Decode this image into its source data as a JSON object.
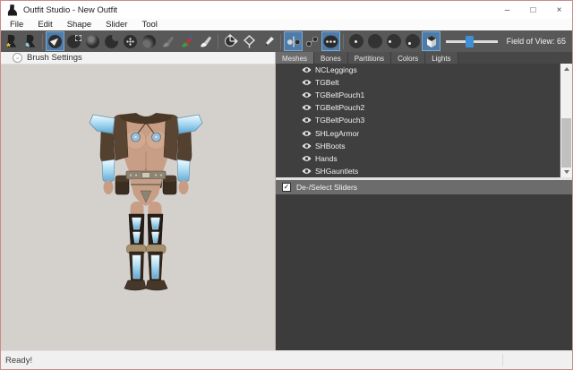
{
  "window": {
    "title": "Outfit Studio - New Outfit",
    "controls": {
      "minimize": "–",
      "maximize": "□",
      "close": "×"
    }
  },
  "menu": {
    "items": [
      "File",
      "Edit",
      "Shape",
      "Slider",
      "Tool"
    ]
  },
  "toolbar": {
    "field_of_view_label": "Field of View: 65",
    "field_of_view_value": 65,
    "tools": [
      {
        "name": "load-outfit",
        "state": "normal"
      },
      {
        "name": "load-reference",
        "state": "normal"
      },
      {
        "name": "select-tool",
        "state": "active"
      },
      {
        "name": "mask-brush",
        "state": "normal"
      },
      {
        "name": "inflate-brush",
        "state": "normal"
      },
      {
        "name": "deflate-brush",
        "state": "normal"
      },
      {
        "name": "move-brush",
        "state": "normal"
      },
      {
        "name": "smooth-brush",
        "state": "normal"
      },
      {
        "name": "weight-brush",
        "state": "disabled"
      },
      {
        "name": "color-brush",
        "state": "normal"
      },
      {
        "name": "alpha-brush",
        "state": "normal"
      },
      {
        "name": "transform-tool",
        "state": "normal"
      },
      {
        "name": "pivot-tool",
        "state": "normal"
      },
      {
        "name": "vertex-edit-tool",
        "state": "normal"
      },
      {
        "name": "x-mirror-toggle",
        "state": "active"
      },
      {
        "name": "edit-connected-toggle",
        "state": "normal"
      },
      {
        "name": "global-brush-collision-toggle",
        "state": "active"
      },
      {
        "name": "brush-falloff-1",
        "state": "normal"
      },
      {
        "name": "brush-falloff-2",
        "state": "normal"
      },
      {
        "name": "brush-falloff-3",
        "state": "normal"
      },
      {
        "name": "brush-falloff-4",
        "state": "normal"
      },
      {
        "name": "perspective-toggle",
        "state": "active"
      }
    ]
  },
  "left_panel": {
    "header": "Brush Settings"
  },
  "right_panel": {
    "tabs": [
      {
        "label": "Meshes",
        "selected": true
      },
      {
        "label": "Bones",
        "selected": false
      },
      {
        "label": "Partitions",
        "selected": false
      },
      {
        "label": "Colors",
        "selected": false
      },
      {
        "label": "Lights",
        "selected": false
      }
    ],
    "mesh_list": [
      {
        "label": "NCLeggings"
      },
      {
        "label": "TGBelt"
      },
      {
        "label": "TGBeltPouch1"
      },
      {
        "label": "TGBeltPouch2"
      },
      {
        "label": "TGBeltPouch3"
      },
      {
        "label": "SHLegArmor"
      },
      {
        "label": "SHBoots"
      },
      {
        "label": "Hands"
      },
      {
        "label": "SHGauntlets"
      }
    ],
    "sliders_panel": {
      "header": "De-/Select Sliders",
      "checked": true,
      "check_glyph": "✓"
    }
  },
  "status_bar": {
    "text": "Ready!"
  },
  "colors": {
    "toolbar_bg": "#585858",
    "active_tool_highlight": "#4e7ba8",
    "panel_dark": "#3f3f3f",
    "viewport_bg": "#d4d1cd",
    "slider_accent": "#3f8fd6",
    "window_border": "#c98c8c"
  }
}
